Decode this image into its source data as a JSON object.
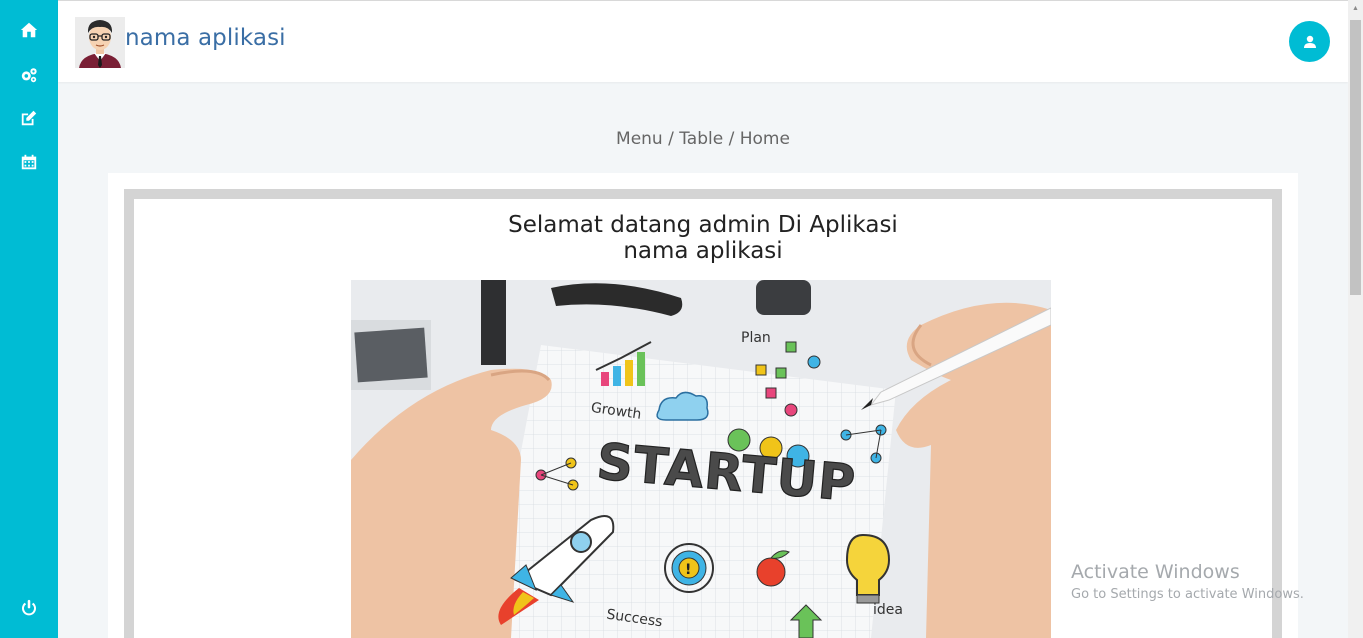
{
  "app": {
    "name": "nama aplikasi"
  },
  "sidebar": {
    "items": [
      {
        "icon": "home-icon"
      },
      {
        "icon": "gears-icon"
      },
      {
        "icon": "edit-icon"
      },
      {
        "icon": "calendar-icon"
      }
    ],
    "logout_icon": "power-icon"
  },
  "header": {
    "user_icon": "user-icon"
  },
  "breadcrumb": "Menu / Table / Home",
  "content": {
    "welcome_line1": "Selamat datang admin Di Aplikasi",
    "welcome_line2": "nama aplikasi",
    "hero": {
      "title": "STARTUP",
      "doodles": [
        "Plan",
        "Growth",
        "Success",
        "idea"
      ]
    }
  },
  "watermark": {
    "title": "Activate Windows",
    "subtitle": "Go to Settings to activate Windows."
  },
  "colors": {
    "accent": "#00bcd4",
    "app_name": "#3a6ea5"
  }
}
